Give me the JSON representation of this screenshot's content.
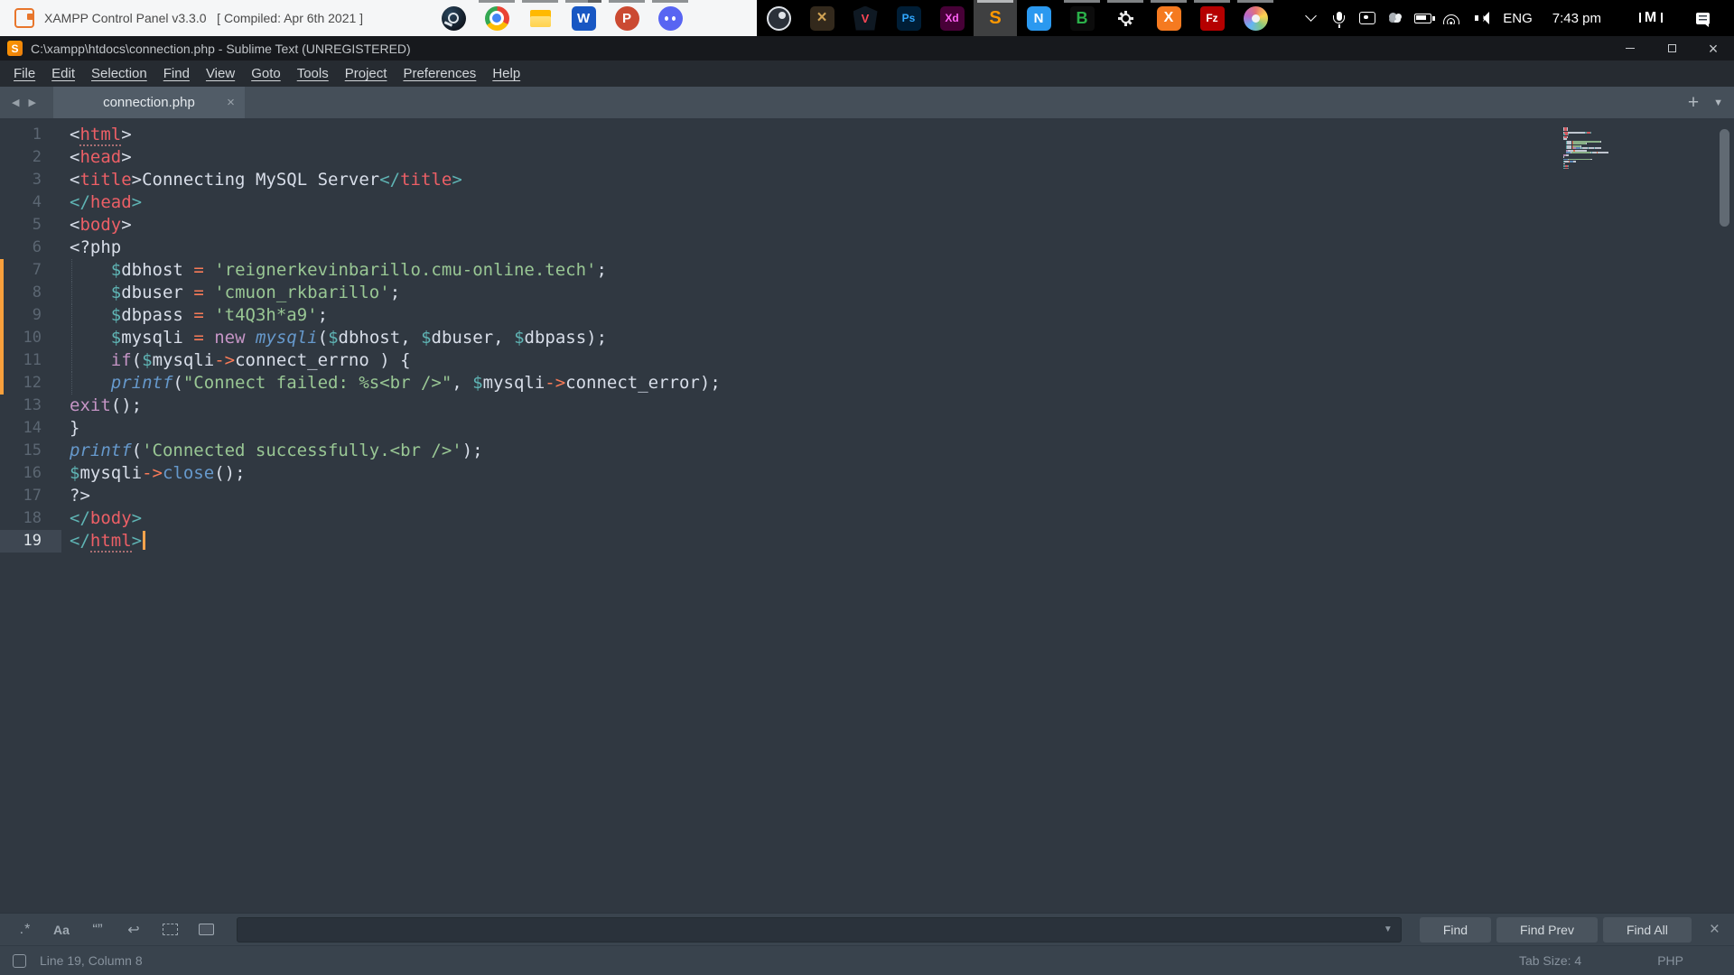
{
  "taskbar": {
    "window_button": {
      "label": "XAMPP Control Panel v3.3.0   [ Compiled: Apr 6th 2021 ]"
    },
    "pinned": [
      {
        "name": "steam",
        "section": "light",
        "running": false,
        "active": false,
        "glyph": ""
      },
      {
        "name": "chrome",
        "section": "light",
        "running": true,
        "active": false,
        "glyph": ""
      },
      {
        "name": "explorer",
        "section": "light",
        "running": true,
        "active": false,
        "glyph": ""
      },
      {
        "name": "word",
        "section": "light",
        "running": true,
        "active": false,
        "glyph": "W",
        "bar": "two"
      },
      {
        "name": "powerpoint",
        "section": "light",
        "running": true,
        "active": false,
        "glyph": "P"
      },
      {
        "name": "discord",
        "section": "light",
        "running": true,
        "active": false,
        "glyph": ""
      },
      {
        "name": "obs",
        "section": "dark",
        "running": false,
        "active": false,
        "glyph": ""
      },
      {
        "name": "game",
        "section": "dark",
        "running": false,
        "active": false,
        "glyph": "×"
      },
      {
        "name": "valorant",
        "section": "dark",
        "running": false,
        "active": false,
        "glyph": "V"
      },
      {
        "name": "photoshop",
        "section": "dark",
        "running": false,
        "active": false,
        "glyph": "Ps"
      },
      {
        "name": "xd",
        "section": "dark",
        "running": false,
        "active": false,
        "glyph": "Xd"
      },
      {
        "name": "sublime",
        "section": "dark",
        "running": true,
        "active": true,
        "glyph": "S"
      },
      {
        "name": "notes",
        "section": "dark",
        "running": false,
        "active": false,
        "glyph": "N"
      },
      {
        "name": "bapp",
        "section": "dark",
        "running": true,
        "active": false,
        "glyph": "B"
      },
      {
        "name": "settings",
        "section": "dark",
        "running": true,
        "active": false,
        "glyph": ""
      },
      {
        "name": "xampp",
        "section": "dark",
        "running": true,
        "active": false,
        "glyph": "X"
      },
      {
        "name": "filezilla",
        "section": "dark",
        "running": true,
        "active": false,
        "glyph": "Fz"
      },
      {
        "name": "paint",
        "section": "dark",
        "running": true,
        "active": false,
        "glyph": ""
      }
    ],
    "tray": {
      "icons": [
        "hidden-icons-chevron",
        "microphone",
        "camera",
        "onedrive-cloud",
        "battery-charging",
        "wifi",
        "volume"
      ],
      "language": "ENG",
      "time": "7:43 pm",
      "right_icons": [
        "medal-m",
        "notifications"
      ],
      "medal_glyph": "M"
    }
  },
  "window": {
    "title": "C:\\xampp\\htdocs\\connection.php - Sublime Text (UNREGISTERED)",
    "controls": [
      "minimize",
      "maximize",
      "close"
    ]
  },
  "menu": {
    "items": [
      "File",
      "Edit",
      "Selection",
      "Find",
      "View",
      "Goto",
      "Tools",
      "Project",
      "Preferences",
      "Help"
    ]
  },
  "tabs": {
    "active_label": "connection.php",
    "close_glyph": "×",
    "new_tab_glyph": "+",
    "overflow_glyph": "▼",
    "nav_back_glyph": "◀",
    "nav_fwd_glyph": "▶"
  },
  "editor": {
    "cursor": {
      "line": 19,
      "column": 8
    },
    "lines": [
      {
        "n": 1,
        "tokens": [
          [
            "<",
            "p"
          ],
          [
            "html",
            "t u"
          ],
          [
            ">",
            "p"
          ]
        ]
      },
      {
        "n": 2,
        "tokens": [
          [
            "<",
            "p"
          ],
          [
            "head",
            "t"
          ],
          [
            ">",
            "p"
          ]
        ]
      },
      {
        "n": 3,
        "tokens": [
          [
            "<",
            "p"
          ],
          [
            "title",
            "t"
          ],
          [
            ">",
            "p"
          ],
          [
            "Connecting MySQL Server",
            "w"
          ],
          [
            "</",
            "c"
          ],
          [
            "title",
            "t"
          ],
          [
            ">",
            "c"
          ]
        ]
      },
      {
        "n": 4,
        "tokens": [
          [
            "</",
            "c"
          ],
          [
            "head",
            "t"
          ],
          [
            ">",
            "c"
          ]
        ]
      },
      {
        "n": 5,
        "tokens": [
          [
            "<",
            "p"
          ],
          [
            "body",
            "t"
          ],
          [
            ">",
            "p"
          ]
        ]
      },
      {
        "n": 6,
        "tokens": [
          [
            "<?php",
            "w"
          ]
        ]
      },
      {
        "n": 7,
        "mark": true,
        "guide": true,
        "tokens": [
          [
            "    ",
            "w"
          ],
          [
            "$",
            "c"
          ],
          [
            "dbhost",
            "w"
          ],
          [
            " ",
            "w"
          ],
          [
            "=",
            "o"
          ],
          [
            " ",
            "w"
          ],
          [
            "'reignerkevinbarillo.cmu-online.tech'",
            "s"
          ],
          [
            ";",
            "w"
          ]
        ]
      },
      {
        "n": 8,
        "mark": true,
        "guide": true,
        "tokens": [
          [
            "    ",
            "w"
          ],
          [
            "$",
            "c"
          ],
          [
            "dbuser",
            "w"
          ],
          [
            " ",
            "w"
          ],
          [
            "=",
            "o"
          ],
          [
            " ",
            "w"
          ],
          [
            "'cmuon_rkbarillo'",
            "s"
          ],
          [
            ";",
            "w"
          ]
        ]
      },
      {
        "n": 9,
        "mark": true,
        "guide": true,
        "tokens": [
          [
            "    ",
            "w"
          ],
          [
            "$",
            "c"
          ],
          [
            "dbpass",
            "w"
          ],
          [
            " ",
            "w"
          ],
          [
            "=",
            "o"
          ],
          [
            " ",
            "w"
          ],
          [
            "'t4Q3h*a9'",
            "s"
          ],
          [
            ";",
            "w"
          ]
        ]
      },
      {
        "n": 10,
        "mark": true,
        "guide": true,
        "tokens": [
          [
            "    ",
            "w"
          ],
          [
            "$",
            "c"
          ],
          [
            "mysqli",
            "w"
          ],
          [
            " ",
            "w"
          ],
          [
            "=",
            "o"
          ],
          [
            " ",
            "w"
          ],
          [
            "new",
            "k"
          ],
          [
            " ",
            "w"
          ],
          [
            "mysqli",
            "f"
          ],
          [
            "(",
            "w"
          ],
          [
            "$",
            "c"
          ],
          [
            "dbhost",
            "w"
          ],
          [
            ", ",
            "w"
          ],
          [
            "$",
            "c"
          ],
          [
            "dbuser",
            "w"
          ],
          [
            ", ",
            "w"
          ],
          [
            "$",
            "c"
          ],
          [
            "dbpass",
            "w"
          ],
          [
            ");",
            "w"
          ]
        ]
      },
      {
        "n": 11,
        "mark": true,
        "guide": true,
        "tokens": [
          [
            "    ",
            "w"
          ],
          [
            "if",
            "k"
          ],
          [
            "(",
            "w"
          ],
          [
            "$",
            "c"
          ],
          [
            "mysqli",
            "w"
          ],
          [
            "->",
            "o"
          ],
          [
            "connect_errno",
            "w"
          ],
          [
            " ) {",
            "w"
          ]
        ]
      },
      {
        "n": 12,
        "mark": true,
        "guide": true,
        "tokens": [
          [
            "    ",
            "w"
          ],
          [
            "printf",
            "f"
          ],
          [
            "(",
            "w"
          ],
          [
            "\"Connect failed: %s<br />\"",
            "s"
          ],
          [
            ", ",
            "w"
          ],
          [
            "$",
            "c"
          ],
          [
            "mysqli",
            "w"
          ],
          [
            "->",
            "o"
          ],
          [
            "connect_error",
            "w"
          ],
          [
            ");",
            "w"
          ]
        ]
      },
      {
        "n": 13,
        "tokens": [
          [
            "exit",
            "k"
          ],
          [
            "();",
            "w"
          ]
        ]
      },
      {
        "n": 14,
        "tokens": [
          [
            "}",
            "w"
          ]
        ]
      },
      {
        "n": 15,
        "tokens": [
          [
            "printf",
            "f"
          ],
          [
            "(",
            "w"
          ],
          [
            "'Connected successfully.<br />'",
            "s"
          ],
          [
            ");",
            "w"
          ]
        ]
      },
      {
        "n": 16,
        "tokens": [
          [
            "$",
            "c"
          ],
          [
            "mysqli",
            "w"
          ],
          [
            "->",
            "o"
          ],
          [
            "close",
            "F"
          ],
          [
            "();",
            "w"
          ]
        ]
      },
      {
        "n": 17,
        "tokens": [
          [
            "?>",
            "w"
          ]
        ]
      },
      {
        "n": 18,
        "tokens": [
          [
            "</",
            "c"
          ],
          [
            "body",
            "t"
          ],
          [
            ">",
            "c"
          ]
        ]
      },
      {
        "n": 19,
        "current": true,
        "caret": true,
        "tokens": [
          [
            "</",
            "c"
          ],
          [
            "html",
            "t u"
          ],
          [
            ">",
            "c"
          ]
        ]
      }
    ]
  },
  "find_panel": {
    "toggles": [
      {
        "name": "regex",
        "glyph": ".*"
      },
      {
        "name": "case-sensitive",
        "glyph": "Aa"
      },
      {
        "name": "whole-word",
        "glyph": "“”"
      },
      {
        "name": "wrap",
        "glyph": "↩"
      },
      {
        "name": "in-selection",
        "glyph": ""
      },
      {
        "name": "highlight-matches",
        "glyph": ""
      }
    ],
    "input_value": "",
    "dropdown_glyph": "▼",
    "buttons": [
      "Find",
      "Find Prev",
      "Find All"
    ],
    "close_glyph": "×"
  },
  "status_bar": {
    "position": "Line 19, Column 8",
    "tab_size": "Tab Size: 4",
    "syntax": "PHP"
  }
}
